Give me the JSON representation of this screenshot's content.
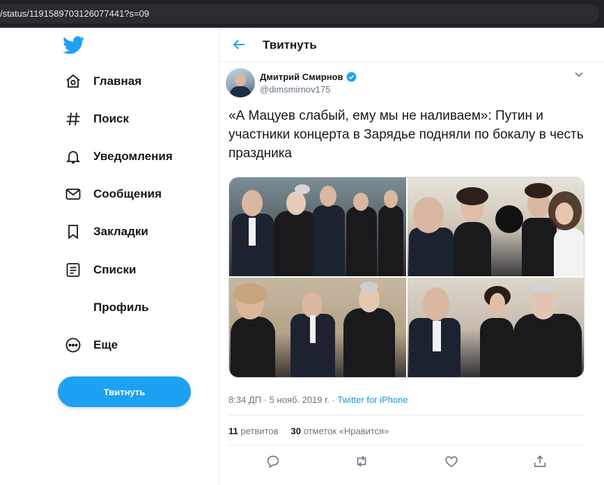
{
  "browser": {
    "url": "/status/1191589703126077441?s=09"
  },
  "sidebar": {
    "logo": "twitter-bird-icon",
    "items": [
      {
        "label": "Главная",
        "icon": "home-icon"
      },
      {
        "label": "Поиск",
        "icon": "hashtag-icon"
      },
      {
        "label": "Уведомления",
        "icon": "bell-icon"
      },
      {
        "label": "Сообщения",
        "icon": "envelope-icon"
      },
      {
        "label": "Закладки",
        "icon": "bookmark-icon"
      },
      {
        "label": "Списки",
        "icon": "list-icon"
      },
      {
        "label": "Профиль",
        "icon": ""
      },
      {
        "label": "Еще",
        "icon": "more-icon"
      }
    ],
    "tweet_button": "Твитнуть"
  },
  "header": {
    "title": "Твитнуть"
  },
  "tweet": {
    "author_name": "Дмитрий Смирнов",
    "author_handle": "@dimsmirnov175",
    "text": "«А Мацуев слабый, ему мы не наливаем»: Путин и участники концерта в Зарядье подняли по бокалу в честь праздника",
    "timestamp": "8:34 ДП · 5 нояб. 2019 г. · ",
    "source": "Twitter for iPhone",
    "retweets_count": "11",
    "retweets_label": "ретвитов",
    "likes_count": "30",
    "likes_label": "отметок «Нравится»"
  },
  "colors": {
    "accent": "#1da1f2",
    "muted": "#657786",
    "text": "#14171a"
  }
}
